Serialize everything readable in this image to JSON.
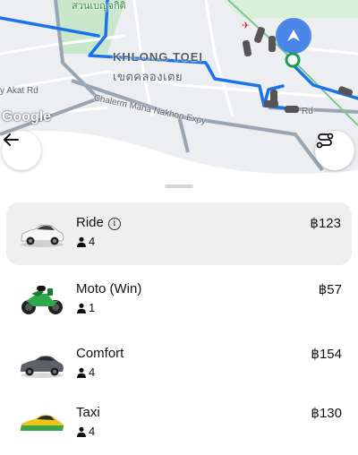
{
  "map": {
    "district_en": "KHLONG TOEI",
    "district_th": "เขตคลองเตย",
    "place_top": "สวนเบญจกิติ",
    "road_expy": "Chalerm Maha Nakhon Expy",
    "road_akat": "y Akat Rd",
    "road_rd": "Rd",
    "google_label": "Google",
    "route_color": "#1a73e8",
    "water_color": "#ffffff",
    "park_color": "#bfe3c3",
    "location_color": "#4285f4",
    "pickup_color": "#1aa04b"
  },
  "controls": {
    "back_icon": "arrow-left-icon",
    "route_icon": "route-options-icon"
  },
  "rides": [
    {
      "name": "Ride",
      "seats": "4",
      "price": "฿123",
      "has_info": true,
      "vehicle": "sedan-white",
      "selected": true
    },
    {
      "name": "Moto (Win)",
      "seats": "1",
      "price": "฿57",
      "has_info": false,
      "vehicle": "motorbike-green",
      "selected": false
    },
    {
      "name": "Comfort",
      "seats": "4",
      "price": "฿154",
      "has_info": false,
      "vehicle": "sedan-gray",
      "selected": false
    },
    {
      "name": "Taxi",
      "seats": "4",
      "price": "฿130",
      "has_info": false,
      "vehicle": "taxi-yellow-green",
      "selected": false
    }
  ]
}
